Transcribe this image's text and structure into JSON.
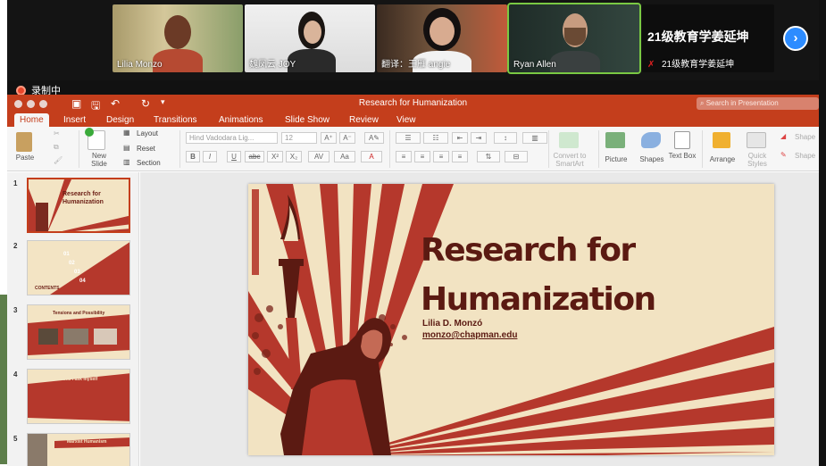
{
  "zoom": {
    "participants": [
      {
        "name": "Lilia Monzo"
      },
      {
        "name": "魏凤云 JOY"
      },
      {
        "name": "翻译：王雁 angie"
      },
      {
        "name": "Ryan Allen"
      },
      {
        "name": "21级教育学姜延坤",
        "big_label": "21级教育学姜延坤"
      }
    ],
    "recording_label": "录制中",
    "next_icon": "chevron-right-icon"
  },
  "ppt": {
    "doc_title": "Research for Humanization",
    "search_placeholder": "Search in Presentation",
    "tabs": [
      "Home",
      "Insert",
      "Design",
      "Transitions",
      "Animations",
      "Slide Show",
      "Review",
      "View"
    ],
    "active_tab": "Home",
    "ribbon": {
      "paste": "Paste",
      "new_slide": "New Slide",
      "layout": "Layout",
      "reset": "Reset",
      "section": "Section",
      "font_name": "Hind Vadodara Lig...",
      "font_size": "12",
      "bold": "B",
      "italic": "I",
      "underline": "U",
      "strike": "abc",
      "superscript": "X²",
      "subscript": "X₂",
      "convert_smartart": "Convert to SmartArt",
      "picture": "Picture",
      "shapes": "Shapes",
      "text_box": "Text Box",
      "arrange": "Arrange",
      "quick_styles": "Quick Styles",
      "shape_fill": "Shape",
      "shape_outline": "Shape"
    },
    "slides": [
      {
        "num": "1",
        "title": "Research for Humanization"
      },
      {
        "num": "2",
        "title": "CONTENTS",
        "items": [
          "01",
          "02",
          "03",
          "04"
        ]
      },
      {
        "num": "3",
        "title": "Tensions and Possibility"
      },
      {
        "num": "4",
        "title": "Questions I ask myself"
      },
      {
        "num": "5",
        "title": "Marxist Humanism"
      }
    ],
    "current_slide": {
      "title_line1": "Research for",
      "title_line2": "Humanization",
      "author": "Lilia D. Monzó",
      "email": "monzo@chapman.edu"
    }
  },
  "colors": {
    "ppt_accent": "#c43e1c",
    "slide_bg": "#f2e3c2",
    "slide_red": "#b5382c",
    "slide_text": "#5b1a12",
    "zoom_next": "#2d8cff"
  }
}
